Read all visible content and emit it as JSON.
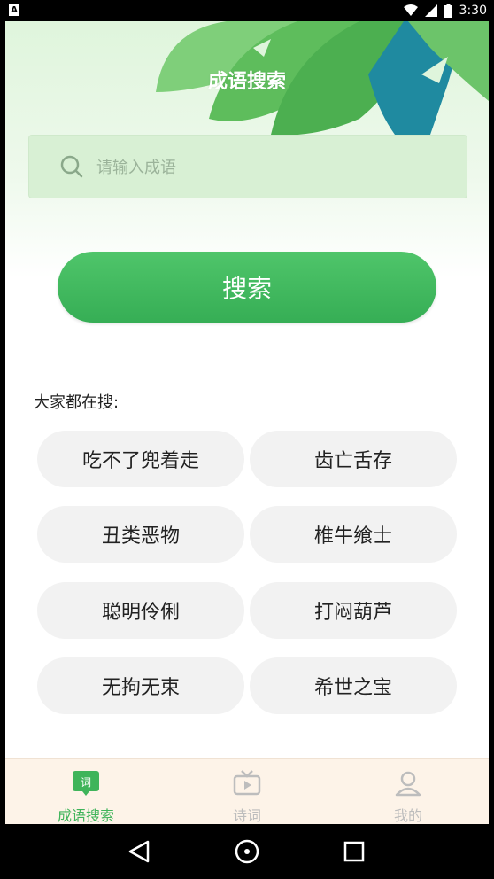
{
  "status_bar": {
    "time": "3:30"
  },
  "header": {
    "title": "成语搜索"
  },
  "search": {
    "placeholder": "请输入成语",
    "value": "",
    "button_label": "搜索"
  },
  "popular": {
    "title": "大家都在搜:",
    "items": [
      "吃不了兜着走",
      "齿亡舌存",
      "丑类恶物",
      "椎牛飨士",
      "聪明伶俐",
      "打闷葫芦",
      "无拘无束",
      "希世之宝"
    ]
  },
  "tabs": [
    {
      "label": "成语搜索",
      "icon": "word-icon",
      "active": true
    },
    {
      "label": "诗词",
      "icon": "tv-icon",
      "active": false
    },
    {
      "label": "我的",
      "icon": "person-icon",
      "active": false
    }
  ],
  "colors": {
    "accent": "#3fb45a",
    "tabbar_bg": "#fdf3e8",
    "chip_bg": "#f2f2f2"
  }
}
